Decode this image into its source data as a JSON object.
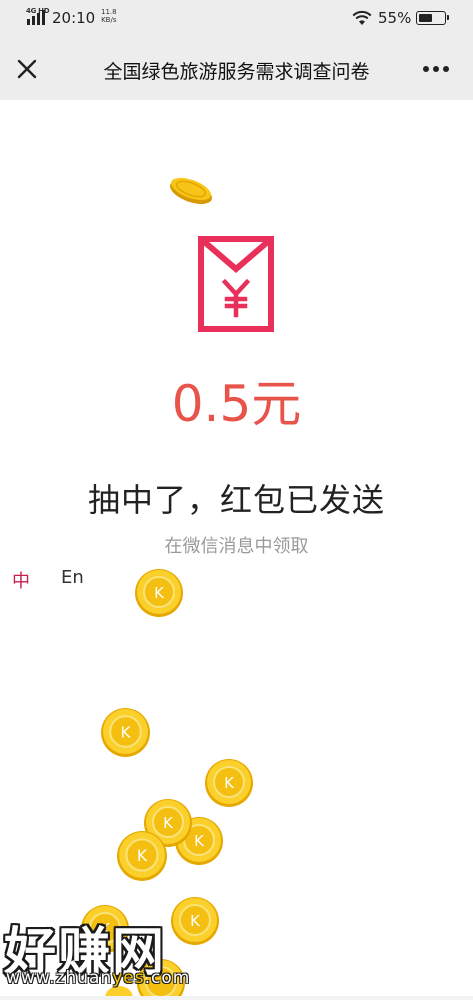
{
  "status_bar": {
    "network": "4G HD",
    "time": "20:10",
    "speed_value": "11.8",
    "speed_unit": "KB/s",
    "battery_percent": "55%",
    "battery_level": 0.55
  },
  "nav": {
    "title": "全国绿色旅游服务需求调查问卷",
    "close_icon": "close-icon",
    "more_icon": "more-icon"
  },
  "result": {
    "amount": "0.5元",
    "title": "抽中了，红包已发送",
    "subtitle": "在微信消息中领取"
  },
  "language": {
    "zh": "中",
    "en": "En"
  },
  "watermark": {
    "text": "好赚网",
    "url_prefix": "www.zhuan",
    "url_highlight": "yes",
    "url_suffix": ".com"
  },
  "colors": {
    "accent": "#e8534a",
    "envelope": "#e8305a",
    "lang_active": "#c8224a",
    "coin": "#f2c200"
  }
}
